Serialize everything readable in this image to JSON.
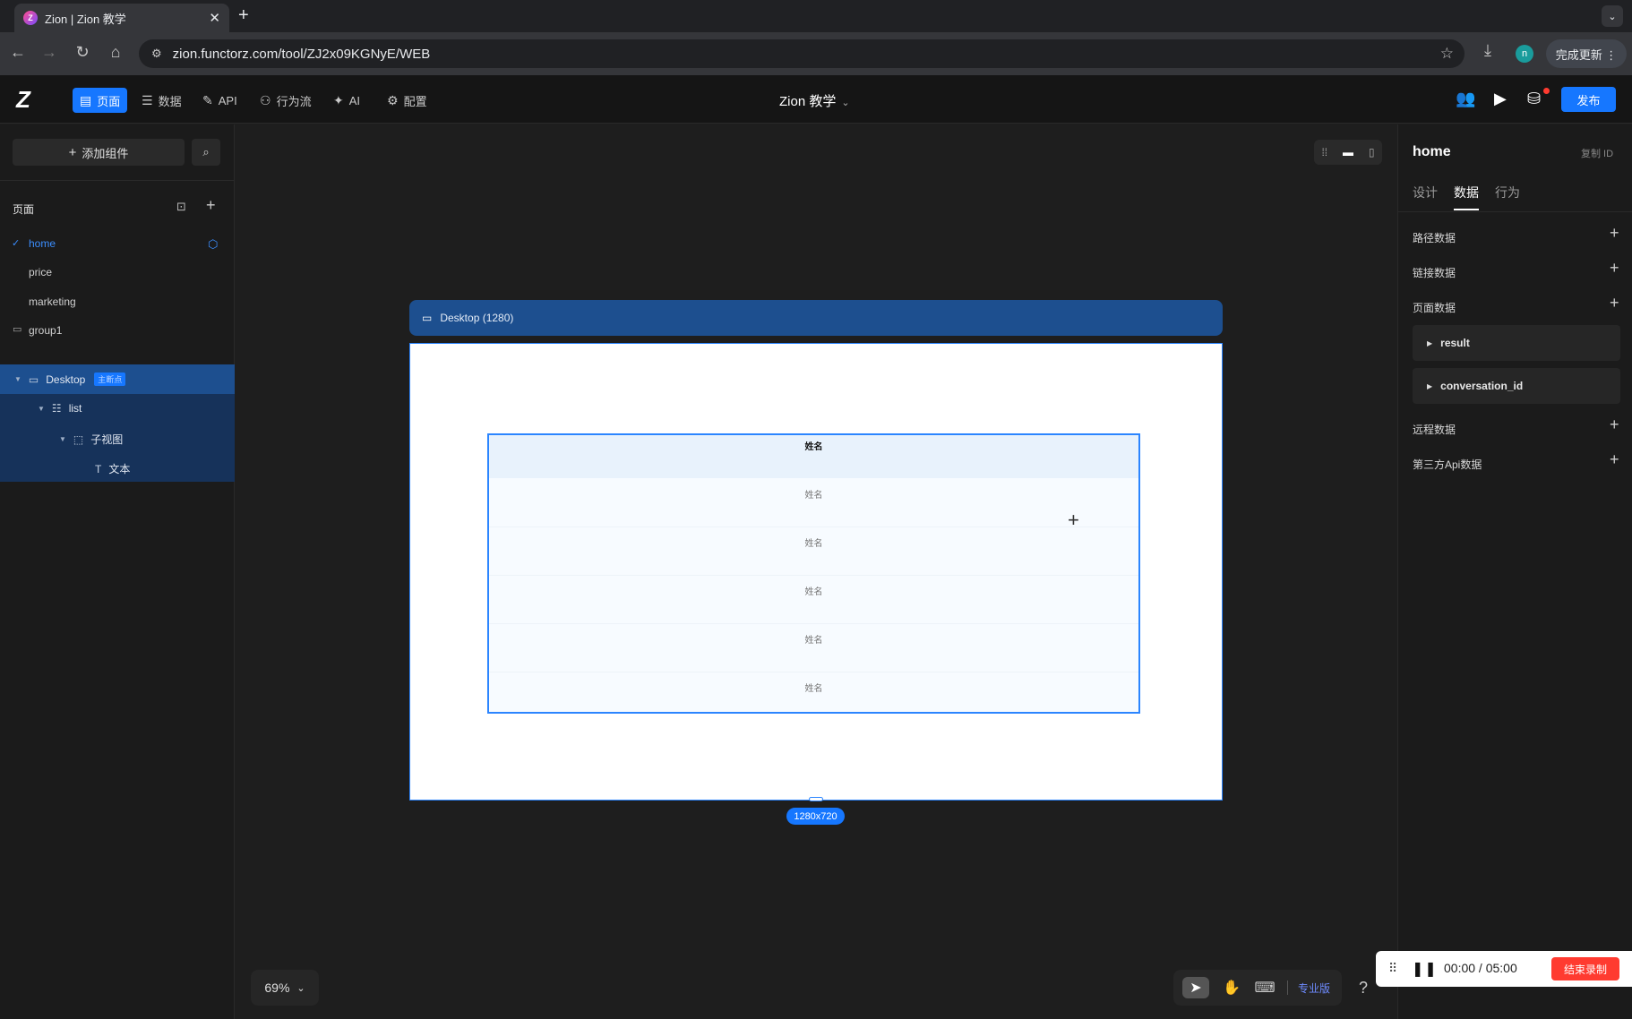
{
  "browser": {
    "tab_title": "Zion | Zion 教学",
    "tab_close": "✕",
    "new_tab": "+",
    "url": "zion.functorz.com/tool/ZJ2x09KGNyE/WEB",
    "profile_initial": "n",
    "update_button": "完成更新 ⋮"
  },
  "appbar": {
    "logo": "Z",
    "nav": [
      {
        "label": "页面",
        "icon": "page-icon"
      },
      {
        "label": "数据",
        "icon": "database-icon"
      },
      {
        "label": "API",
        "icon": "api-icon"
      },
      {
        "label": "行为流",
        "icon": "workflow-icon"
      },
      {
        "label": "AI",
        "icon": "ai-icon"
      },
      {
        "label": "配置",
        "icon": "gear-icon"
      }
    ],
    "project_title": "Zion 教学",
    "publish": "发布"
  },
  "left": {
    "add_component": "添加组件",
    "pages_label": "页面",
    "pages": [
      "home",
      "price",
      "marketing",
      "group1"
    ],
    "tree": {
      "desktop": "Desktop",
      "main_badge": "主断点",
      "list": "list",
      "subview": "子视图",
      "text": "文本"
    }
  },
  "canvas": {
    "frame_label": "Desktop (1280)",
    "list_header": "姓名",
    "list_rows": [
      "姓名",
      "姓名",
      "姓名",
      "姓名",
      "姓名"
    ],
    "size_badge": "1280x720",
    "zoom": "69%",
    "pro_label": "专业版",
    "help": "?"
  },
  "right": {
    "title": "home",
    "copy_id": "复制 ID",
    "tabs": [
      "设计",
      "数据",
      "行为"
    ],
    "sections": {
      "route": "路径数据",
      "link": "链接数据",
      "page": "页面数据",
      "remote": "远程数据",
      "thirdparty": "第三方Api数据"
    },
    "page_vars": [
      "result",
      "conversation_id"
    ]
  },
  "recorder": {
    "time": "00:00  /  05:00",
    "stop": "结束录制"
  }
}
